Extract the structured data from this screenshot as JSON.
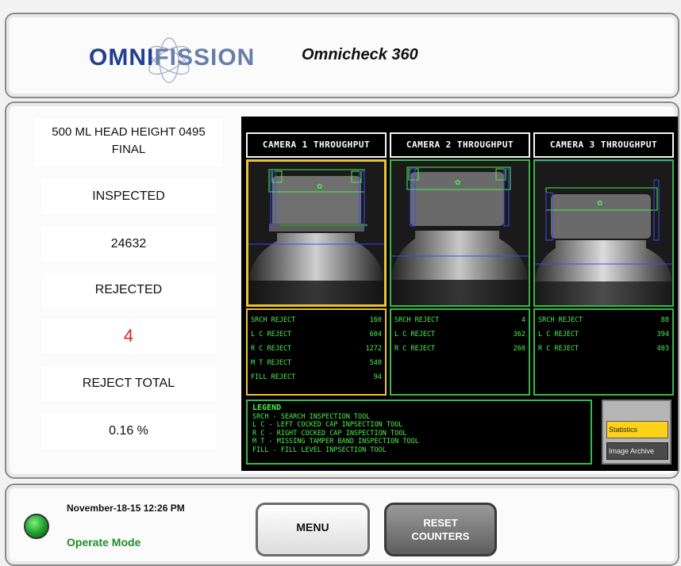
{
  "header": {
    "logo_text_a": "OMNI",
    "logo_text_b": "FISSION",
    "app_title": "Omnicheck 360"
  },
  "job": {
    "name": "500 ML HEAD HEIGHT 0495 FINAL"
  },
  "stats": {
    "inspected_label": "INSPECTED",
    "inspected_value": "24632",
    "rejected_label": "REJECTED",
    "rejected_value": "4",
    "reject_total_label": "REJECT TOTAL",
    "reject_total_value": "0.16 %"
  },
  "cameras": [
    {
      "title": "CAMERA 1 THROUGHPUT",
      "rows": [
        {
          "label": "SRCH REJECT",
          "value": "160"
        },
        {
          "label": "L C REJECT",
          "value": "604"
        },
        {
          "label": "R C REJECT",
          "value": "1272"
        },
        {
          "label": "M T REJECT",
          "value": "540"
        },
        {
          "label": "FILL REJECT",
          "value": "94"
        }
      ]
    },
    {
      "title": "CAMERA 2 THROUGHPUT",
      "rows": [
        {
          "label": "SRCH REJECT",
          "value": "4"
        },
        {
          "label": "L C REJECT",
          "value": "362"
        },
        {
          "label": "R C REJECT",
          "value": "260"
        }
      ]
    },
    {
      "title": "CAMERA 3 THROUGHPUT",
      "rows": [
        {
          "label": "SRCH REJECT",
          "value": "88"
        },
        {
          "label": "L C REJECT",
          "value": "394"
        },
        {
          "label": "R C REJECT",
          "value": "403"
        }
      ]
    }
  ],
  "legend": {
    "title": "LEGEND",
    "lines": [
      "SRCH - SEARCH INSPECTION TOOL",
      "L C - LEFT COCKED CAP INPSECTION TOOL",
      "R C - RIGHT COCKED CAP INSPECTION TOOL",
      "M T - MISSING TAMPER BAND INSPECTION TOOL",
      "FILL - FILL LEVEL INPSECTION TOOL"
    ]
  },
  "side_buttons": {
    "statistics": "Statistics",
    "image_archive": "Image Archive"
  },
  "footer": {
    "datetime": "November-18-15 12:26 PM",
    "mode": "Operate Mode",
    "menu_label": "MENU",
    "reset_label": "RESET\nCOUNTERS"
  },
  "colors": {
    "reject_value": "#e02020",
    "brand_blue": "#23408e",
    "screen_green": "#4cf04c",
    "highlight_yellow": "#ffd21a"
  }
}
